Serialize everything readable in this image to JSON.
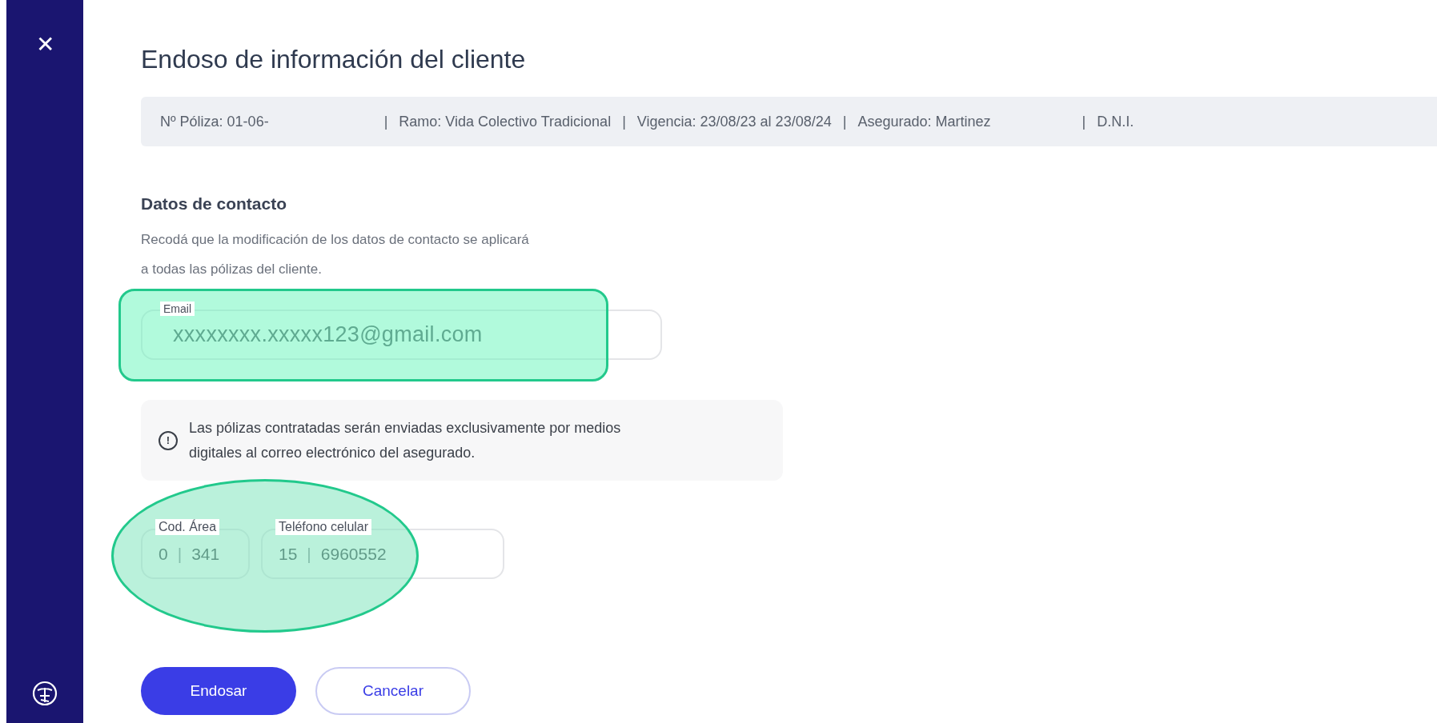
{
  "sidebar": {
    "close": "✕"
  },
  "title": "Endoso de información del cliente",
  "policy_bar": [
    "Nº Póliza: 01-06-",
    "Ramo: Vida Colectivo Tradicional",
    "Vigencia: 23/08/23 al 23/08/24",
    "Asegurado: Martinez",
    "D.N.I."
  ],
  "separator": "|",
  "section": {
    "heading": "Datos de contacto",
    "description_lines": [
      "Recodá que la modificación de los datos de contacto se aplicará",
      "a todas las pólizas del cliente."
    ]
  },
  "email": {
    "label": "Email",
    "value": "xxxxxxxx.xxxxx123@gmail.com",
    "highlighted": true
  },
  "notice": {
    "icon": "!",
    "text_lines": [
      "Las pólizas contratadas serán enviadas exclusivamente por medios",
      "digitales al correo electrónico del asegurado."
    ]
  },
  "phone": {
    "highlighted": true,
    "fields": [
      {
        "label": "Cod. Área",
        "prefix": "0",
        "value": "341"
      },
      {
        "label": "Teléfono celular",
        "prefix": "15",
        "value": "6960552"
      }
    ]
  },
  "buttons": [
    {
      "label": "Endosar",
      "kind": "primary"
    },
    {
      "label": "Cancelar",
      "kind": "secondary"
    }
  ]
}
